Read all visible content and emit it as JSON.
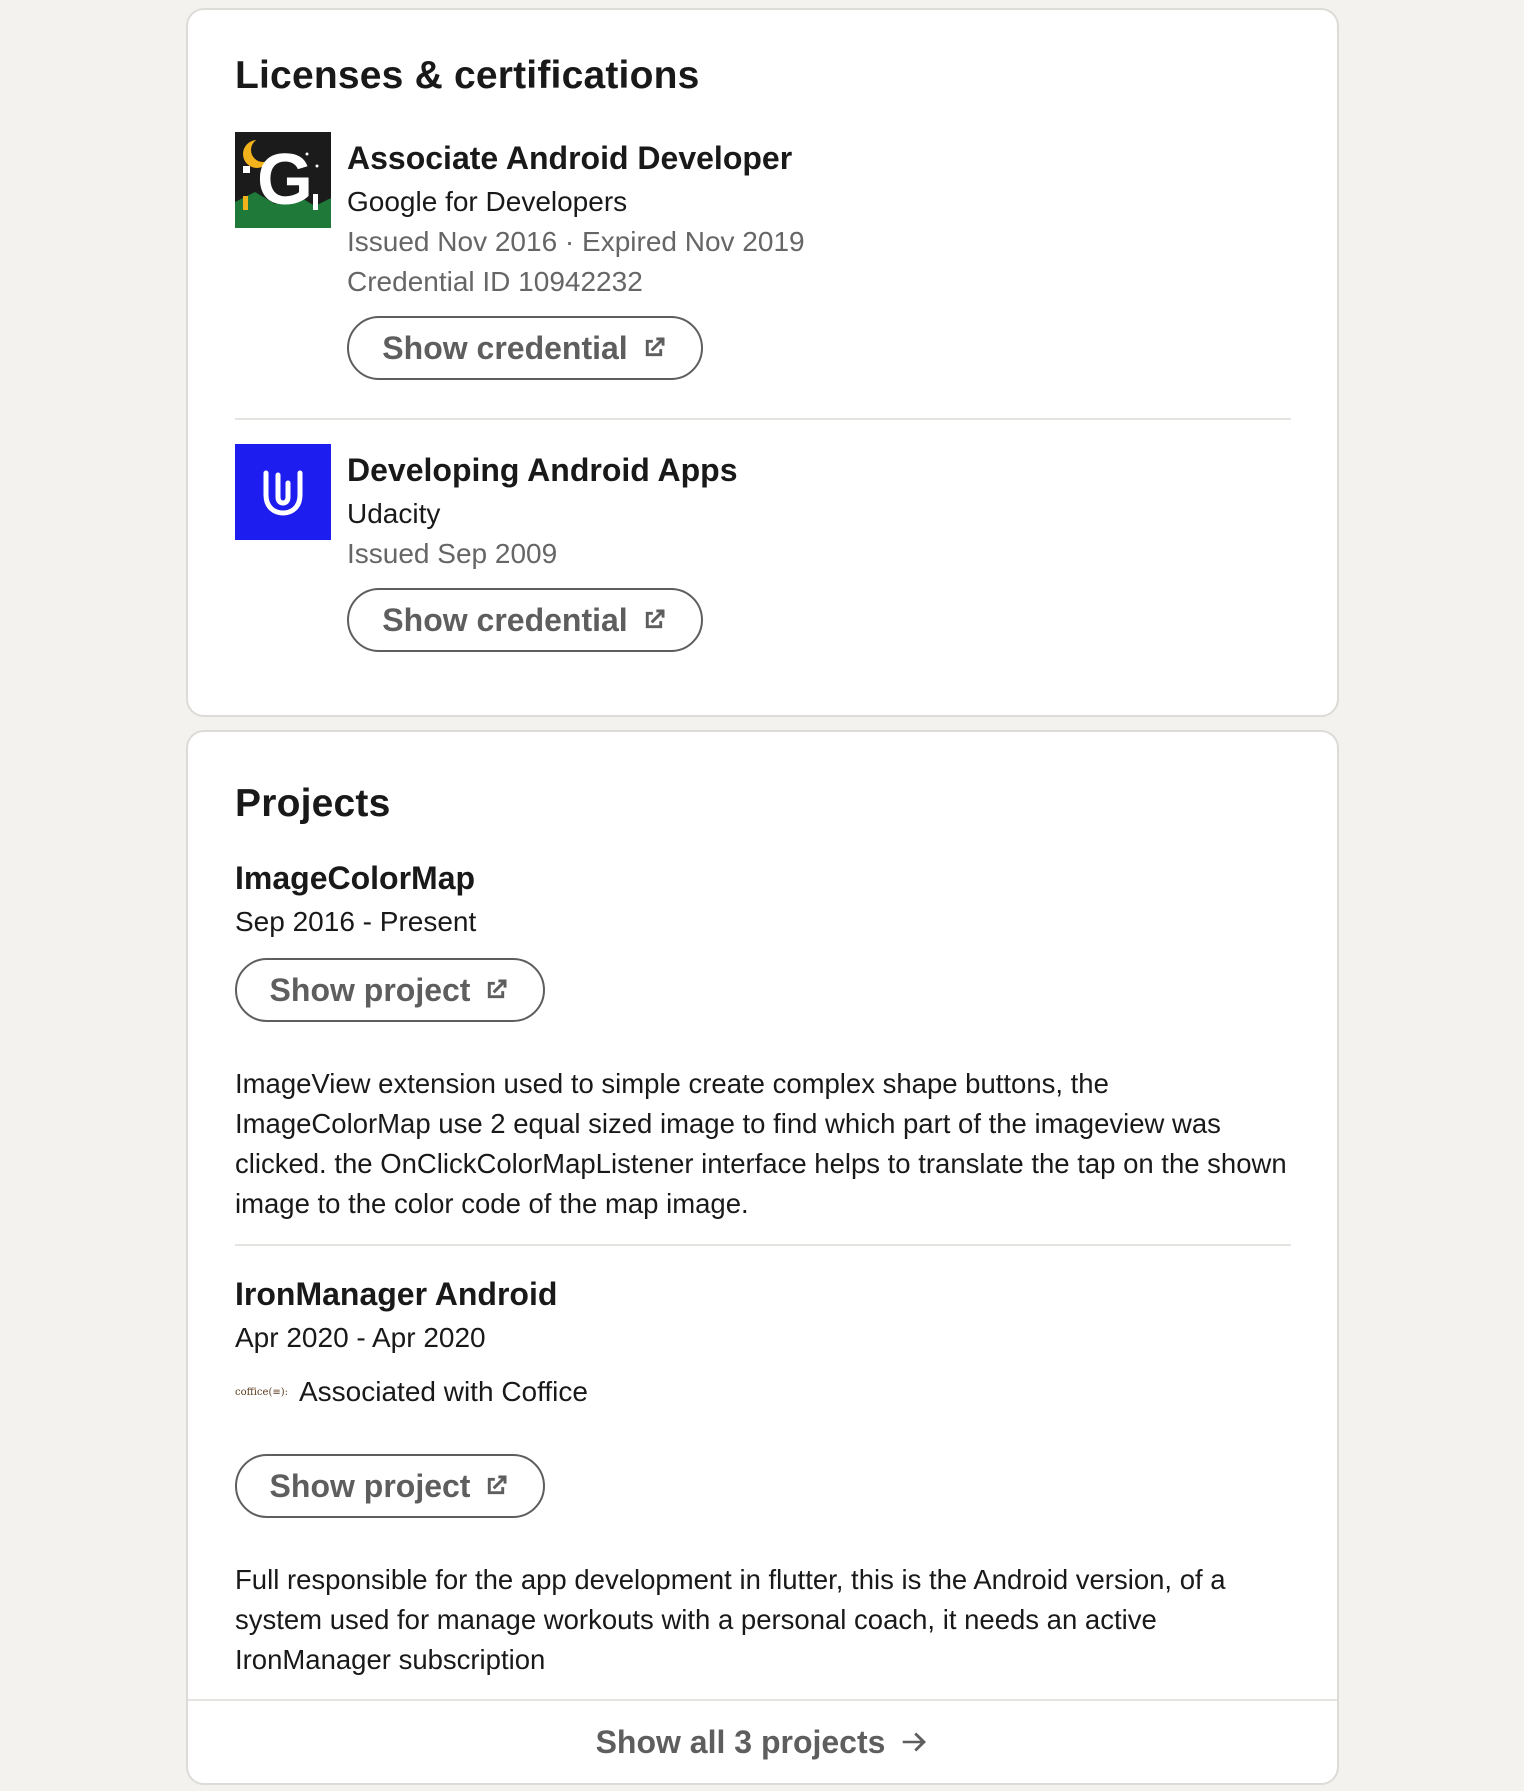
{
  "licenses": {
    "title": "Licenses & certifications",
    "items": [
      {
        "logo": "google-for-developers-logo",
        "name": "Associate Android Developer",
        "issuer": "Google for Developers",
        "dates": "Issued Nov 2016 · Expired Nov 2019",
        "credential_id": "Credential ID 10942232",
        "button_label": "Show credential"
      },
      {
        "logo": "udacity-logo",
        "name": "Developing Android Apps",
        "issuer": "Udacity",
        "dates": "Issued Sep 2009",
        "button_label": "Show credential"
      }
    ]
  },
  "projects": {
    "title": "Projects",
    "items": [
      {
        "name": "ImageColorMap",
        "dates": "Sep 2016 - Present",
        "button_label": "Show project",
        "description": "ImageView extension used to simple create complex shape buttons, the ImageColorMap use 2 equal sized image to find which part of the imageview was clicked. the OnClickColorMapListener interface helps to translate the tap on the shown image to the color code of the map image."
      },
      {
        "name": "IronManager Android",
        "dates": "Apr 2020 - Apr 2020",
        "associated_logo_text": "coffice(≡):",
        "associated": "Associated with Coffice",
        "button_label": "Show project",
        "description": "Full responsible for the app development in flutter, this is the Android version, of a system used for manage workouts with a personal coach, it needs an active IronManager subscription"
      }
    ],
    "show_all_label": "Show all 3 projects"
  },
  "colors": {
    "page_bg": "#f3f2ef",
    "card_bg": "#ffffff",
    "text_primary": "#191919",
    "text_secondary": "#666666",
    "button_gray": "#5e5e5e",
    "udacity_blue": "#1d1df0"
  }
}
